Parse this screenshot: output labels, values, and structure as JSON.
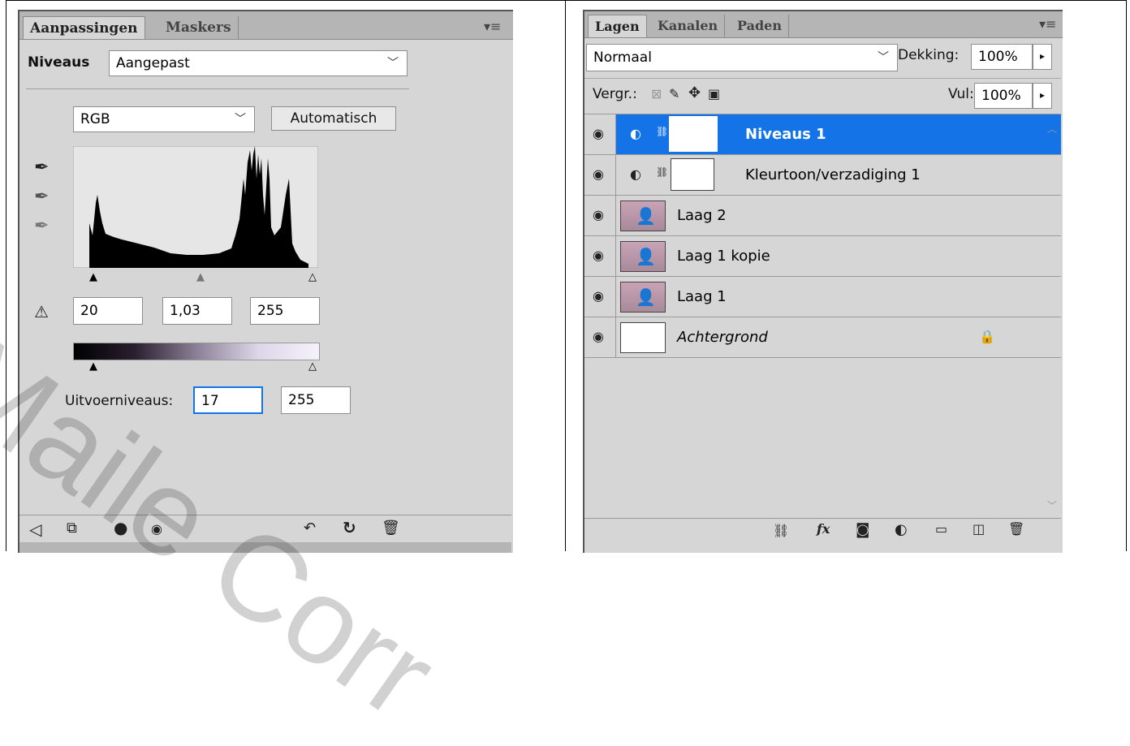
{
  "adjustments": {
    "tabs": [
      "Aanpassingen",
      "Maskers"
    ],
    "title": "Niveaus",
    "preset": "Aangepast",
    "channel": "RGB",
    "auto_button": "Automatisch",
    "input_black": "20",
    "input_gamma": "1,03",
    "input_white": "255",
    "output_label": "Uitvoerniveaus:",
    "output_black": "17",
    "output_white": "255"
  },
  "layers_panel": {
    "tabs": [
      "Lagen",
      "Kanalen",
      "Paden"
    ],
    "blend_mode": "Normaal",
    "opacity_label": "Dekking:",
    "opacity_value": "100%",
    "lock_label": "Vergr.:",
    "fill_label": "Vul:",
    "fill_value": "100%",
    "layers": [
      {
        "name": "Niveaus 1",
        "selected": true
      },
      {
        "name": "Kleurtoon/verzadiging 1",
        "selected": false
      },
      {
        "name": "Laag 2",
        "selected": false
      },
      {
        "name": "Laag 1 kopie",
        "selected": false
      },
      {
        "name": "Laag 1",
        "selected": false
      },
      {
        "name": "Achtergrond",
        "selected": false
      }
    ]
  },
  "watermark": "Maile Corr",
  "colors": {
    "panel_bg": "#d6d6d6",
    "tab_bar": "#b5b5b5",
    "selection": "#1473e6",
    "field_focus": "#1473e6"
  }
}
